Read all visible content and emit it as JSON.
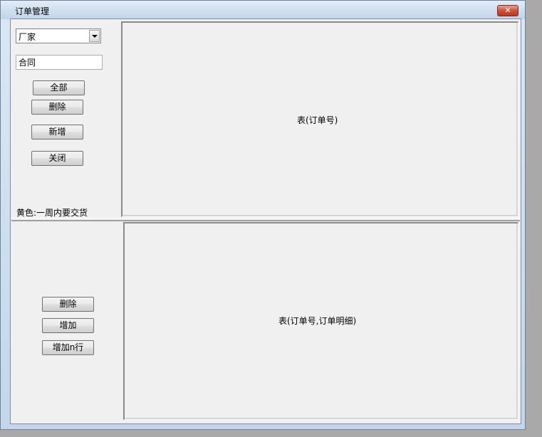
{
  "window": {
    "title": "订单管理",
    "close_label": "✕"
  },
  "top_panel": {
    "manufacturer_select": {
      "value": "厂家"
    },
    "contract_field": {
      "value": "合同"
    },
    "buttons": {
      "all": "全部",
      "delete": "删除",
      "add": "新增",
      "close": "关闭"
    },
    "legend": "黄色:一周内要交货",
    "table_caption": "表(订单号)"
  },
  "bottom_panel": {
    "buttons": {
      "delete": "删除",
      "add": "增加",
      "add_n_rows": "增加n行"
    },
    "table_caption": "表(订单号,订单明细)"
  }
}
